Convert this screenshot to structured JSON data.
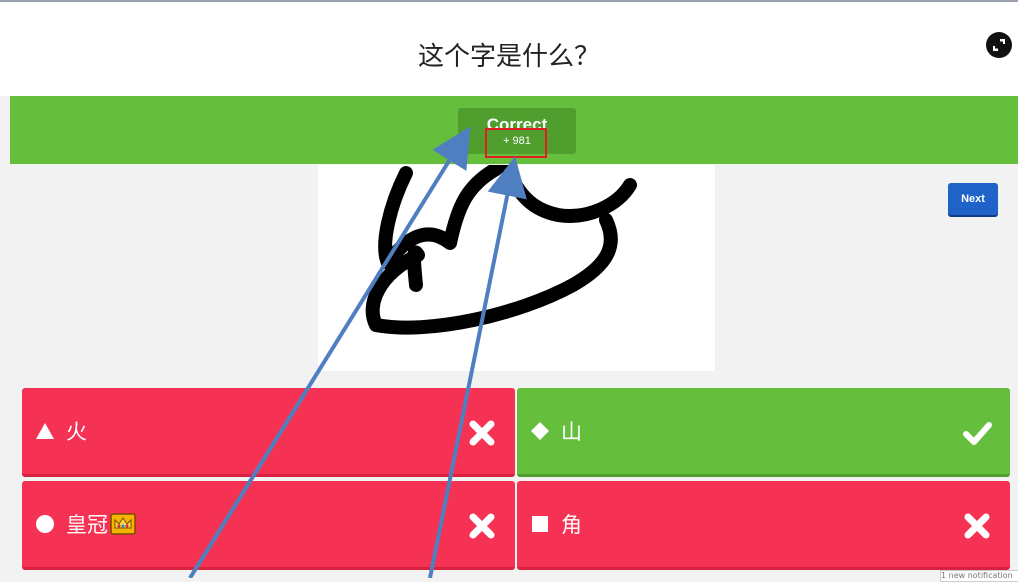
{
  "question": {
    "text": "这个字是什么？"
  },
  "result": {
    "title": "Correct",
    "points": "+ 981"
  },
  "next_button": {
    "label": "Next"
  },
  "answers": [
    {
      "shape": "triangle-icon",
      "label": "火",
      "status": "wrong"
    },
    {
      "shape": "diamond-icon",
      "label": "山",
      "status": "correct"
    },
    {
      "shape": "circle-icon",
      "label": "皇冠",
      "emoji": "crown-icon",
      "status": "wrong"
    },
    {
      "shape": "square-icon",
      "label": "角",
      "status": "wrong"
    }
  ],
  "notification": {
    "text": "1 new notification"
  },
  "colors": {
    "correct_green": "#66bf3c",
    "wrong_red": "#f53253",
    "next_blue": "#1f63c8",
    "highlight_red": "#e02020",
    "arrow_blue": "#4f7fc0"
  }
}
